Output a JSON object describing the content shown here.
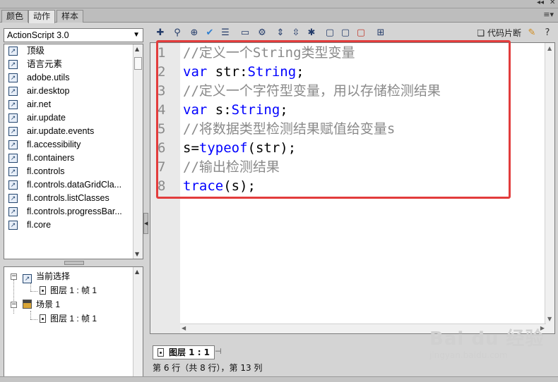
{
  "window": {
    "minimize_control": "◂◂",
    "close_control": "✕"
  },
  "tabs": [
    {
      "label": "颜色"
    },
    {
      "label": "动作"
    },
    {
      "label": "样本"
    }
  ],
  "panel_menu_glyph": "≡▾",
  "left_panel": {
    "version_select": "ActionScript 3.0",
    "books": [
      "顶级",
      "语言元素",
      "adobe.utils",
      "air.desktop",
      "air.net",
      "air.update",
      "air.update.events",
      "fl.accessibility",
      "fl.containers",
      "fl.controls",
      "fl.controls.dataGridCla...",
      "fl.controls.listClasses",
      "fl.controls.progressBar...",
      "fl.core"
    ],
    "tree": {
      "current_selection": "当前选择",
      "current_frame": "图层 1 : 帧 1",
      "scene": "场景 1",
      "scene_frame": "图层 1 : 帧 1"
    }
  },
  "toolbar": {
    "snippets_label": "代码片断"
  },
  "editor": {
    "lines": [
      {
        "num": "1",
        "tokens": [
          {
            "t": "//定义一个String类型变量",
            "k": "comment"
          }
        ]
      },
      {
        "num": "2",
        "tokens": [
          {
            "t": "var",
            "k": "kw"
          },
          {
            "t": " str:",
            "k": "plain"
          },
          {
            "t": "String",
            "k": "type"
          },
          {
            "t": ";",
            "k": "plain"
          }
        ]
      },
      {
        "num": "3",
        "tokens": [
          {
            "t": "//定义一个字符型变量，用以存储检测结果",
            "k": "comment"
          }
        ]
      },
      {
        "num": "4",
        "tokens": [
          {
            "t": "var",
            "k": "kw"
          },
          {
            "t": " s:",
            "k": "plain"
          },
          {
            "t": "String",
            "k": "type"
          },
          {
            "t": ";",
            "k": "plain"
          }
        ]
      },
      {
        "num": "5",
        "tokens": [
          {
            "t": "//将数据类型检测结果赋值给变量s",
            "k": "comment"
          }
        ]
      },
      {
        "num": "6",
        "tokens": [
          {
            "t": "s=",
            "k": "plain"
          },
          {
            "t": "typeof",
            "k": "kw"
          },
          {
            "t": "(str);",
            "k": "plain"
          }
        ]
      },
      {
        "num": "7",
        "tokens": [
          {
            "t": "//输出检测结果",
            "k": "comment"
          }
        ]
      },
      {
        "num": "8",
        "tokens": [
          {
            "t": "trace",
            "k": "fn"
          },
          {
            "t": "(s);",
            "k": "plain"
          }
        ]
      }
    ]
  },
  "bottom_tab": {
    "label": "图层 1 : 1"
  },
  "status": {
    "text": "第 6 行（共 8 行），第 13 列"
  },
  "watermark": {
    "line1": "Bai du 经验",
    "line2": "jingyan.baidu.com"
  },
  "colors": {
    "comment": "#8a8a8a",
    "keyword": "#0000ff",
    "highlight_box": "#e23c3c"
  }
}
